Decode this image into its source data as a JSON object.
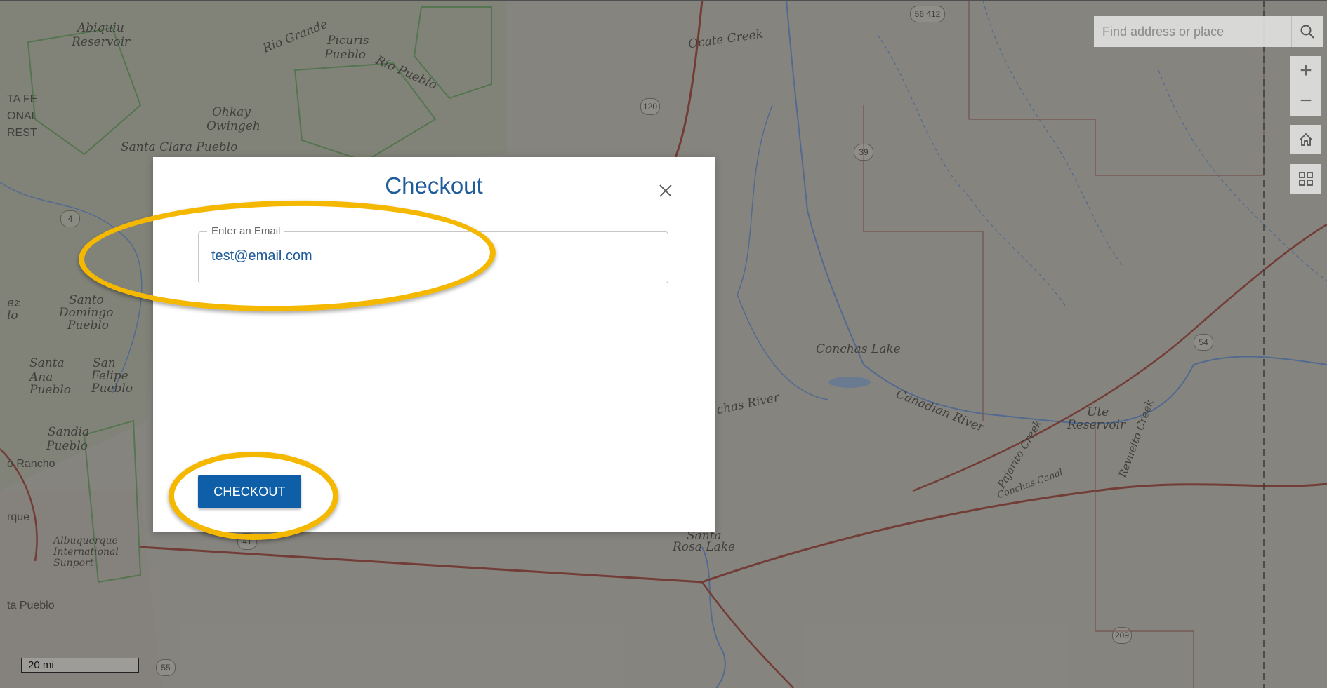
{
  "map": {
    "labels": {
      "abiquiu": "Abiquiu",
      "abiquiu2": "Reservoir",
      "rio_grande": "Rio Grande",
      "picuris": "Picuris",
      "picuris2": "Pueblo",
      "rio_pueblo": "Rio Pueblo",
      "santafe1": "TA FE",
      "santafe2": "ONAL",
      "santafe3": "REST",
      "ohkay": "Ohkay",
      "ohkay2": "Owingeh",
      "santa_clara": "Santa Clara Pueblo",
      "ocate": "Ocate Creek",
      "santo_domingo1": "Santo",
      "santo_domingo2": "Domingo",
      "santo_domingo3": "Pueblo",
      "santa_ana1": "Santa",
      "santa_ana2": "Ana",
      "santa_ana3": "Pueblo",
      "san_felipe1": "San",
      "san_felipe2": "Felipe",
      "san_felipe3": "Pueblo",
      "sandia1": "Sandia",
      "sandia2": "Pueblo",
      "rancho": "o Rancho",
      "erque": "rque",
      "abq1": "Albuquerque",
      "abq2": "International",
      "abq3": "Sunport",
      "ta_pueblo": "ta Pueblo",
      "conchas_lake": "Conchas Lake",
      "canadian": "Canadian River",
      "chas_river": "chas River",
      "ute1": "Ute",
      "ute2": "Reservoir",
      "pajarito": "Pajarito Creek",
      "concho": "Conchas Canal",
      "revuelto": "Revuelto Creek",
      "santa_rosa1": "Santa",
      "santa_rosa2": "Rosa Lake",
      "ez": "ez",
      "lo": "lo"
    },
    "shields": {
      "s1": "4",
      "s2": "120",
      "s3": "39",
      "s4": "54",
      "s5": "41",
      "s6": "55",
      "s7": "209",
      "s8": "56 412"
    }
  },
  "search": {
    "placeholder": "Find address or place",
    "icon": "search-icon"
  },
  "widgets": {
    "zoom_in": "+",
    "zoom_out": "−"
  },
  "scalebar": {
    "label": "20 mi"
  },
  "modal": {
    "title": "Checkout",
    "email_label": "Enter an Email",
    "email_value": "test@email.com",
    "button_label": "CHECKOUT"
  },
  "colors": {
    "annotation": "#f5b800",
    "primary": "#0f5fa8",
    "title": "#1f5c99"
  }
}
